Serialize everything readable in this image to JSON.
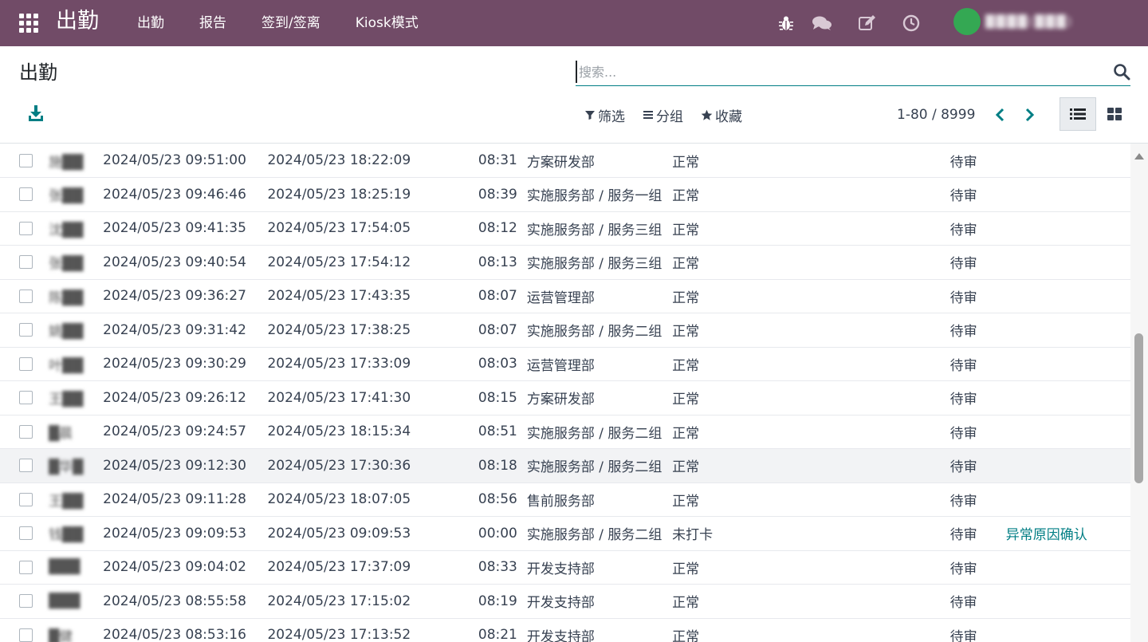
{
  "navbar": {
    "brand": "出勤",
    "menu": [
      "出勤",
      "报告",
      "签到/签离",
      "Kiosk模式"
    ],
    "user_name": "████(███)",
    "colors": {
      "primary": "#714b67",
      "accent": "#017e84",
      "avatar": "#34a853"
    },
    "icons": [
      "bug-icon",
      "chat-icon",
      "edit-icon",
      "clock-icon"
    ]
  },
  "control": {
    "title": "出勤",
    "search_placeholder": "搜索...",
    "filter_label": "筛选",
    "group_label": "分组",
    "favorite_label": "收藏",
    "pager": "1-80 / 8999"
  },
  "rows": [
    {
      "name": "施██",
      "check_in": "2024/05/23 09:51:00",
      "check_out": "2024/05/23 18:22:09",
      "hours": "08:31",
      "dept": "方案研发部",
      "status": "正常",
      "approval": "待审",
      "action": ""
    },
    {
      "name": "张██",
      "check_in": "2024/05/23 09:46:46",
      "check_out": "2024/05/23 18:25:19",
      "hours": "08:39",
      "dept": "实施服务部 / 服务一组",
      "status": "正常",
      "approval": "待审",
      "action": ""
    },
    {
      "name": "沈██",
      "check_in": "2024/05/23 09:41:35",
      "check_out": "2024/05/23 17:54:05",
      "hours": "08:12",
      "dept": "实施服务部 / 服务三组",
      "status": "正常",
      "approval": "待审",
      "action": ""
    },
    {
      "name": "张██",
      "check_in": "2024/05/23 09:40:54",
      "check_out": "2024/05/23 17:54:12",
      "hours": "08:13",
      "dept": "实施服务部 / 服务三组",
      "status": "正常",
      "approval": "待审",
      "action": ""
    },
    {
      "name": "陈██",
      "check_in": "2024/05/23 09:36:27",
      "check_out": "2024/05/23 17:43:35",
      "hours": "08:07",
      "dept": "运营管理部",
      "status": "正常",
      "approval": "待审",
      "action": ""
    },
    {
      "name": "姚██",
      "check_in": "2024/05/23 09:31:42",
      "check_out": "2024/05/23 17:38:25",
      "hours": "08:07",
      "dept": "实施服务部 / 服务二组",
      "status": "正常",
      "approval": "待审",
      "action": ""
    },
    {
      "name": "叶██",
      "check_in": "2024/05/23 09:30:29",
      "check_out": "2024/05/23 17:33:09",
      "hours": "08:03",
      "dept": "运营管理部",
      "status": "正常",
      "approval": "待审",
      "action": ""
    },
    {
      "name": "王██",
      "check_in": "2024/05/23 09:26:12",
      "check_out": "2024/05/23 17:41:30",
      "hours": "08:15",
      "dept": "方案研发部",
      "status": "正常",
      "approval": "待审",
      "action": ""
    },
    {
      "name": "█晨",
      "check_in": "2024/05/23 09:24:57",
      "check_out": "2024/05/23 18:15:34",
      "hours": "08:51",
      "dept": "实施服务部 / 服务二组",
      "status": "正常",
      "approval": "待审",
      "action": ""
    },
    {
      "name": "█华█",
      "check_in": "2024/05/23 09:12:30",
      "check_out": "2024/05/23 17:30:36",
      "hours": "08:18",
      "dept": "实施服务部 / 服务二组",
      "status": "正常",
      "approval": "待审",
      "action": ""
    },
    {
      "name": "王██",
      "check_in": "2024/05/23 09:11:28",
      "check_out": "2024/05/23 18:07:05",
      "hours": "08:56",
      "dept": "售前服务部",
      "status": "正常",
      "approval": "待审",
      "action": ""
    },
    {
      "name": "钱██",
      "check_in": "2024/05/23 09:09:53",
      "check_out": "2024/05/23 09:09:53",
      "hours": "00:00",
      "dept": "实施服务部 / 服务二组",
      "status": "未打卡",
      "approval": "待审",
      "action": "异常原因确认"
    },
    {
      "name": "███",
      "check_in": "2024/05/23 09:04:02",
      "check_out": "2024/05/23 17:37:09",
      "hours": "08:33",
      "dept": "开发支持部",
      "status": "正常",
      "approval": "待审",
      "action": ""
    },
    {
      "name": "███",
      "check_in": "2024/05/23 08:55:58",
      "check_out": "2024/05/23 17:15:02",
      "hours": "08:19",
      "dept": "开发支持部",
      "status": "正常",
      "approval": "待审",
      "action": ""
    },
    {
      "name": "█健",
      "check_in": "2024/05/23 08:53:16",
      "check_out": "2024/05/23 17:13:52",
      "hours": "08:21",
      "dept": "开发支持部",
      "status": "正常",
      "approval": "待审",
      "action": ""
    }
  ]
}
